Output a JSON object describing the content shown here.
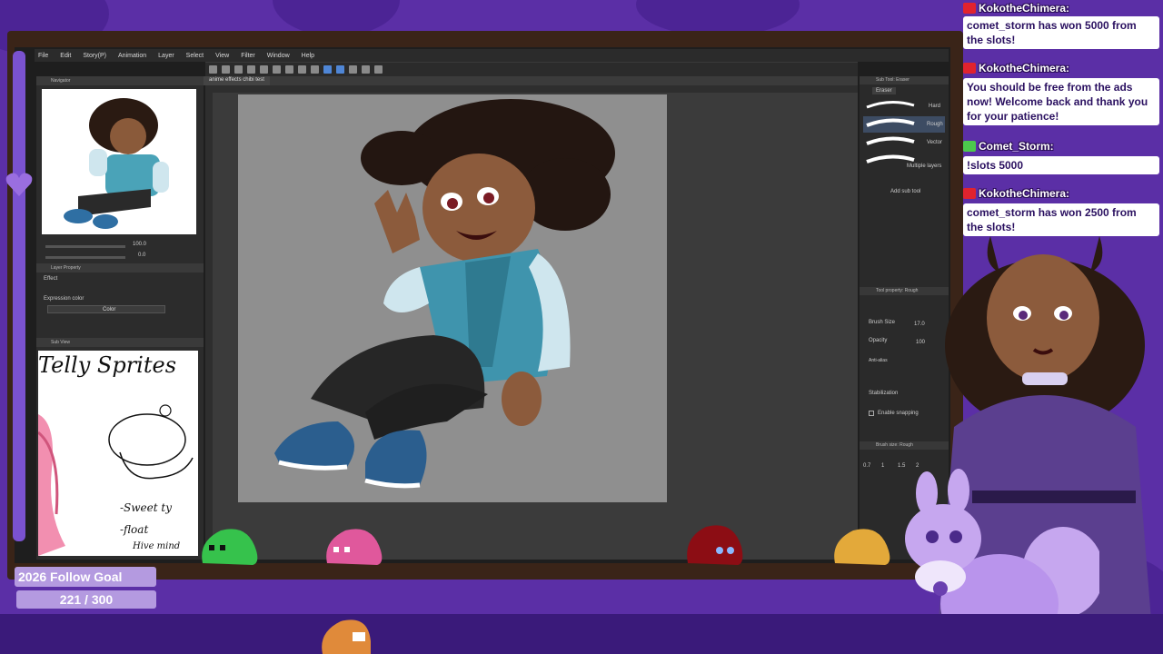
{
  "app": {
    "menu": [
      "File",
      "Edit",
      "Story(P)",
      "Animation",
      "Layer",
      "Select",
      "View",
      "Filter",
      "Window",
      "Help"
    ],
    "document_tab": "anime effects chibi test"
  },
  "left_panel": {
    "navigator_tab": "Navigator",
    "navigator_zoom": "100.0",
    "navigator_angle": "0.0",
    "layer_property_tab": "Layer Property",
    "effect_label": "Effect",
    "expression_color_label": "Expression color",
    "expression_color_value": "Color",
    "sub_view_tab": "Sub View",
    "sub_view_text": {
      "title": "Telly Sprites",
      "note1": "-Sweet ty",
      "note2": "-float",
      "note3": "Hive mind"
    }
  },
  "right_panel": {
    "sub_tool_tab": "Sub Tool: Eraser",
    "eraser_group": "Eraser",
    "brushes": [
      "Hard",
      "Rough",
      "Vector",
      "Multiple layers"
    ],
    "add_sub_tool": "Add sub tool",
    "tool_property_tab": "Tool property: Rough",
    "brush_size_label": "Brush Size",
    "brush_size_value": "17.0",
    "opacity_label": "Opacity",
    "opacity_value": "100",
    "antialias_label": "Anti-alias",
    "stabilization_label": "Stabilization",
    "enable_snapping_label": "Enable snapping",
    "brush_size_tab": "Brush size: Rough",
    "brush_size_presets": [
      "0.7",
      "1",
      "1.5",
      "2"
    ]
  },
  "chat": [
    {
      "user": "KokotheChimera:",
      "message": "comet_storm has won 5000 from the slots!",
      "icon_color": "#e0232e"
    },
    {
      "user": "KokotheChimera:",
      "message": "You should be free from the ads now! Welcome back and thank you for your patience!",
      "icon_color": "#e0232e"
    },
    {
      "user": "Comet_Storm:",
      "message": "!slots 5000",
      "icon_color": "#4cc94c"
    },
    {
      "user": "KokotheChimera:",
      "message": "comet_storm has won 2500 from the slots!",
      "icon_color": "#e0232e"
    }
  ],
  "goal": {
    "label": "2026 Follow Goal",
    "count": "221 / 300",
    "current": 221,
    "target": 300
  },
  "colors": {
    "background": "#5b2fa6",
    "frame": "#3a2418",
    "goal_box": "#b49ae0"
  }
}
